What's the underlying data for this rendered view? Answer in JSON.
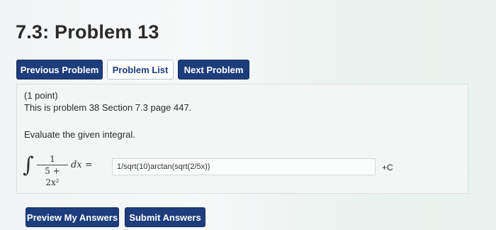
{
  "page": {
    "title": "7.3: Problem 13"
  },
  "nav": {
    "previous_label": "Previous Problem",
    "list_label": "Problem List",
    "next_label": "Next Problem"
  },
  "problem": {
    "points": "(1 point)",
    "reference": "This is problem 38 Section 7.3 page 447.",
    "instruction": "Evaluate the given integral.",
    "formula": {
      "integral_symbol": "∫",
      "numerator": "1",
      "denominator": "5 + 2x²",
      "differential": "dx ="
    },
    "answer_value": "1/sqrt(10)arctan(sqrt(2/5x))",
    "constant": "+C"
  },
  "actions": {
    "preview_label": "Preview My Answers",
    "submit_label": "Submit Answers"
  }
}
